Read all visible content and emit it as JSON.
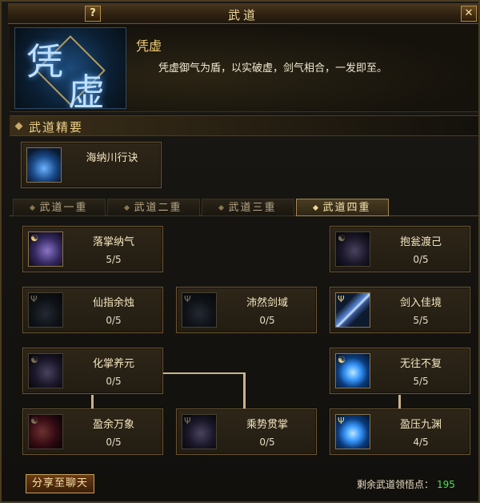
{
  "window": {
    "title": "武道",
    "help_glyph": "?",
    "close_glyph": "✕"
  },
  "header": {
    "emblem_chars": [
      "凭",
      "虚"
    ],
    "skill_name": "凭虚",
    "skill_desc": "凭虚御气为盾，以实破虚，剑气相合，一发即至。"
  },
  "section": {
    "title": "武道精要"
  },
  "essential": {
    "name": "海纳川行诀",
    "icon": "blue-figure-icon"
  },
  "tabs": [
    {
      "label": "武道一重",
      "active": false
    },
    {
      "label": "武道二重",
      "active": false
    },
    {
      "label": "武道三重",
      "active": false
    },
    {
      "label": "武道四重",
      "active": true
    }
  ],
  "skills": [
    {
      "name": "落掌纳气",
      "level": "5/5",
      "icon": "purple-palm-icon",
      "learned": true
    },
    {
      "name": "抱瓮渡己",
      "level": "0/5",
      "icon": "purple-figure-icon",
      "learned": false
    },
    {
      "name": "仙指余烛",
      "level": "0/5",
      "icon": "dark-finger-icon",
      "learned": false
    },
    {
      "name": "沛然剑域",
      "level": "0/5",
      "icon": "dark-orb-icon",
      "learned": false
    },
    {
      "name": "剑入佳境",
      "level": "5/5",
      "icon": "sword-icon",
      "learned": true
    },
    {
      "name": "化掌养元",
      "level": "0/5",
      "icon": "purple-palm-icon",
      "learned": false
    },
    {
      "name": "无往不复",
      "level": "5/5",
      "icon": "blue-orb-icon",
      "learned": true
    },
    {
      "name": "盈余万象",
      "level": "0/5",
      "icon": "red-burst-icon",
      "learned": false
    },
    {
      "name": "乘势贯掌",
      "level": "0/5",
      "icon": "purple-palm-icon",
      "learned": false
    },
    {
      "name": "盈压九渊",
      "level": "4/5",
      "icon": "blue-orb-icon",
      "learned": true
    }
  ],
  "footer": {
    "share_label": "分享至聊天",
    "points_label": "剩余武道领悟点：",
    "points_value": "195"
  }
}
